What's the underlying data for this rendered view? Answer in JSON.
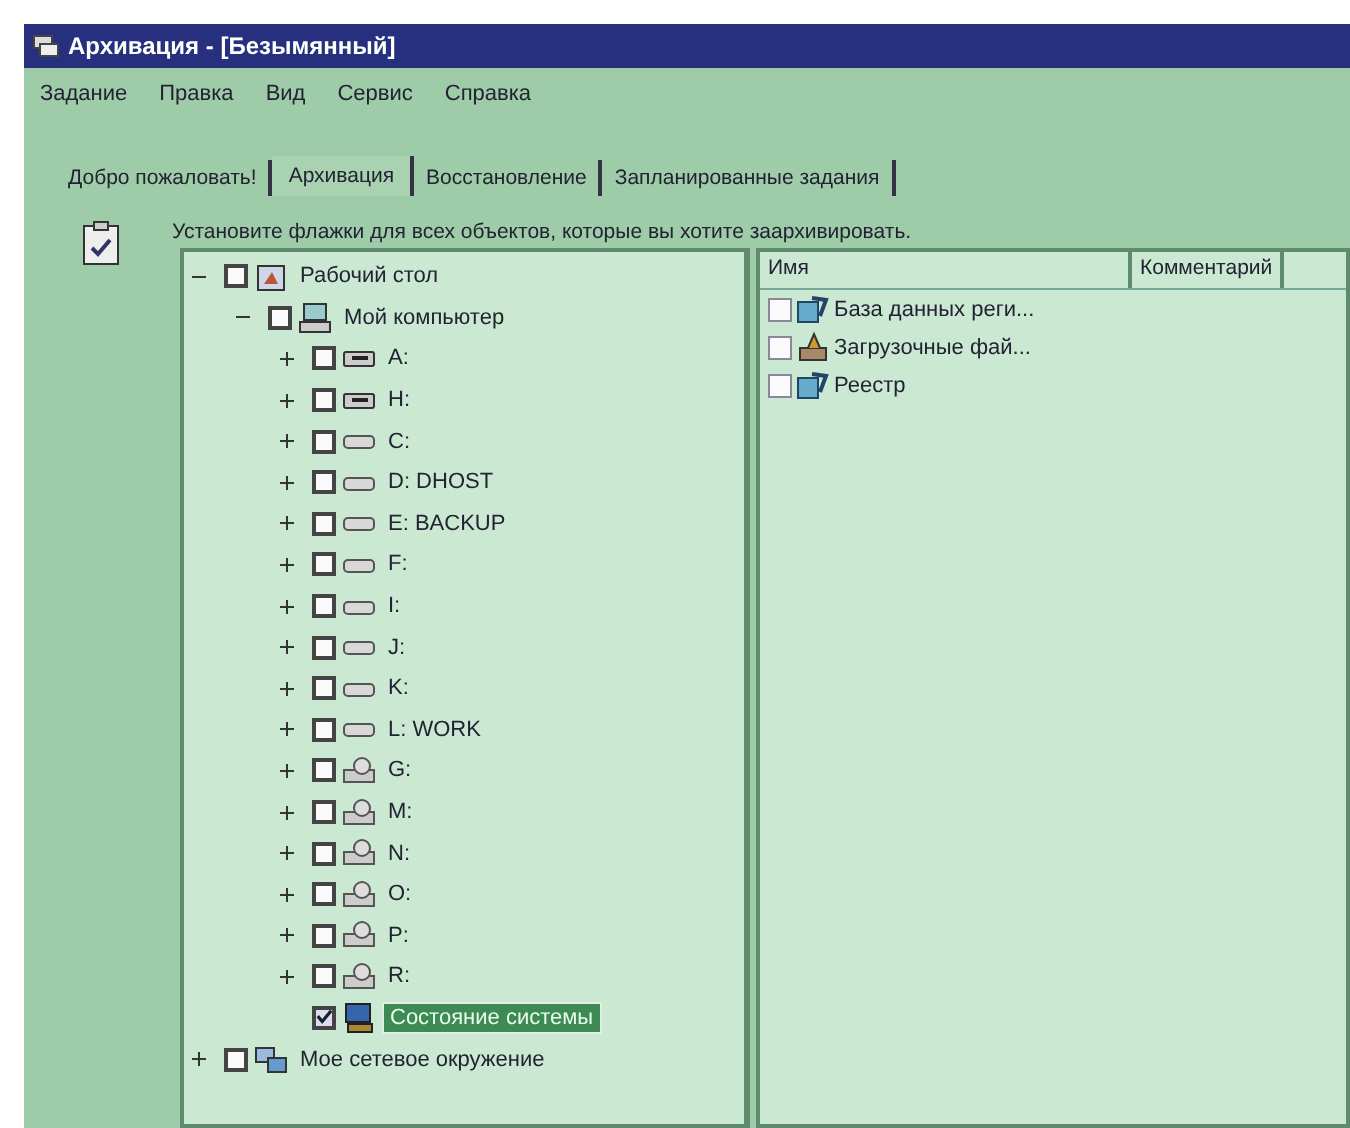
{
  "window": {
    "title": "Архивация - [Безымянный]"
  },
  "menu": [
    "Задание",
    "Правка",
    "Вид",
    "Сервис",
    "Справка"
  ],
  "tabs": [
    {
      "label": "Добро пожаловать!",
      "selected": false
    },
    {
      "label": "Архивация",
      "selected": true
    },
    {
      "label": "Восстановление",
      "selected": false
    },
    {
      "label": "Запланированные задания",
      "selected": false
    }
  ],
  "instruction": "Установите флажки для всех объектов, которые вы хотите заархивировать.",
  "tree": [
    {
      "label": "Рабочий стол",
      "kind": "desktop",
      "checked": false,
      "expanded": true,
      "selected": false,
      "children": [
        {
          "label": "Мой компьютер",
          "kind": "computer",
          "checked": false,
          "expanded": true,
          "selected": false,
          "children": [
            {
              "label": "A:",
              "kind": "floppy",
              "checked": false,
              "expanded": false,
              "selected": false
            },
            {
              "label": "H:",
              "kind": "floppy",
              "checked": false,
              "expanded": false,
              "selected": false
            },
            {
              "label": "C:",
              "kind": "drive",
              "checked": false,
              "expanded": false,
              "selected": false
            },
            {
              "label": "D: DHOST",
              "kind": "drive",
              "checked": false,
              "expanded": false,
              "selected": false
            },
            {
              "label": "E: BACKUP",
              "kind": "drive",
              "checked": false,
              "expanded": false,
              "selected": false
            },
            {
              "label": "F:",
              "kind": "drive",
              "checked": false,
              "expanded": false,
              "selected": false
            },
            {
              "label": "I:",
              "kind": "drive",
              "checked": false,
              "expanded": false,
              "selected": false
            },
            {
              "label": "J:",
              "kind": "drive",
              "checked": false,
              "expanded": false,
              "selected": false
            },
            {
              "label": "K:",
              "kind": "drive",
              "checked": false,
              "expanded": false,
              "selected": false
            },
            {
              "label": "L: WORK",
              "kind": "drive",
              "checked": false,
              "expanded": false,
              "selected": false
            },
            {
              "label": "G:",
              "kind": "cdrom",
              "checked": false,
              "expanded": false,
              "selected": false
            },
            {
              "label": "M:",
              "kind": "cdrom",
              "checked": false,
              "expanded": false,
              "selected": false
            },
            {
              "label": "N:",
              "kind": "cdrom",
              "checked": false,
              "expanded": false,
              "selected": false
            },
            {
              "label": "O:",
              "kind": "cdrom",
              "checked": false,
              "expanded": false,
              "selected": false
            },
            {
              "label": "P:",
              "kind": "cdrom",
              "checked": false,
              "expanded": false,
              "selected": false
            },
            {
              "label": "R:",
              "kind": "cdrom",
              "checked": false,
              "expanded": false,
              "selected": false
            },
            {
              "label": "Состояние системы",
              "kind": "system",
              "checked": true,
              "selected": true
            }
          ]
        }
      ]
    },
    {
      "label": "Мое сетевое окружение",
      "kind": "network",
      "checked": false,
      "expanded": false,
      "selected": false
    }
  ],
  "list": {
    "columns": [
      "Имя",
      "Комментарий"
    ],
    "rows": [
      {
        "name": "База данных реги...",
        "kind": "registry",
        "checked": false
      },
      {
        "name": "Загрузочные фай...",
        "kind": "boot",
        "checked": false
      },
      {
        "name": "Реестр",
        "kind": "registry",
        "checked": false
      }
    ]
  }
}
